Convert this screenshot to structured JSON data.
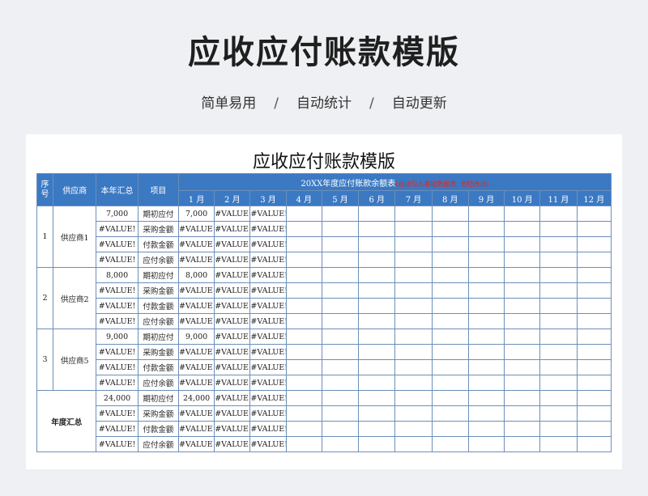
{
  "hero": {
    "title": "应收应付账款模版",
    "features": [
      "简单易用",
      "自动统计",
      "自动更新"
    ],
    "separator": "/"
  },
  "sheet": {
    "title": "应收应付账款模版",
    "headers": {
      "seq": "序号",
      "supplier": "供应商",
      "year_total": "本年汇总",
      "item": "项目",
      "banner": "20XX年度应付账款余额表",
      "banner_note": "(自动引入基础数据表, 勿轻改动)",
      "months": [
        "1 月",
        "2 月",
        "3 月",
        "4 月",
        "5 月",
        "6 月",
        "7 月",
        "8 月",
        "9 月",
        "10 月",
        "11 月",
        "12 月"
      ]
    },
    "groups": [
      {
        "seq": "1",
        "name": "供应商1",
        "rows": [
          {
            "total": "7,000",
            "item": "期初应付",
            "m": [
              "7,000",
              "#VALUE!",
              "#VALUE!"
            ]
          },
          {
            "total": "#VALUE!",
            "item": "采购金额",
            "m": [
              "#VALUE!",
              "#VALUE!",
              "#VALUE!"
            ]
          },
          {
            "total": "#VALUE!",
            "item": "付款金额",
            "m": [
              "#VALUE!",
              "#VALUE!",
              "#VALUE!"
            ]
          },
          {
            "total": "#VALUE!",
            "item": "应付余额",
            "m": [
              "#VALUE!",
              "#VALUE!",
              "#VALUE!"
            ]
          }
        ]
      },
      {
        "seq": "2",
        "name": "供应商2",
        "rows": [
          {
            "total": "8,000",
            "item": "期初应付",
            "m": [
              "8,000",
              "#VALUE!",
              "#VALUE!"
            ]
          },
          {
            "total": "#VALUE!",
            "item": "采购金额",
            "m": [
              "#VALUE!",
              "#VALUE!",
              "#VALUE!"
            ]
          },
          {
            "total": "#VALUE!",
            "item": "付款金额",
            "m": [
              "#VALUE!",
              "#VALUE!",
              "#VALUE!"
            ]
          },
          {
            "total": "#VALUE!",
            "item": "应付余额",
            "m": [
              "#VALUE!",
              "#VALUE!",
              "#VALUE!"
            ]
          }
        ]
      },
      {
        "seq": "3",
        "name": "供应商5",
        "rows": [
          {
            "total": "9,000",
            "item": "期初应付",
            "m": [
              "9,000",
              "#VALUE!",
              "#VALUE!"
            ]
          },
          {
            "total": "#VALUE!",
            "item": "采购金额",
            "m": [
              "#VALUE!",
              "#VALUE!",
              "#VALUE!"
            ]
          },
          {
            "total": "#VALUE!",
            "item": "付款金额",
            "m": [
              "#VALUE!",
              "#VALUE!",
              "#VALUE!"
            ]
          },
          {
            "total": "#VALUE!",
            "item": "应付余额",
            "m": [
              "#VALUE!",
              "#VALUE!",
              "#VALUE!"
            ]
          }
        ]
      }
    ],
    "annual": {
      "label": "年度汇总",
      "rows": [
        {
          "total": "24,000",
          "item": "期初应付",
          "m": [
            "24,000",
            "#VALUE!",
            "#VALUE!"
          ]
        },
        {
          "total": "#VALUE!",
          "item": "采购金额",
          "m": [
            "#VALUE!",
            "#VALUE!",
            "#VALUE!"
          ]
        },
        {
          "total": "#VALUE!",
          "item": "付款金额",
          "m": [
            "#VALUE!",
            "#VALUE!",
            "#VALUE!"
          ]
        },
        {
          "total": "#VALUE!",
          "item": "应付余额",
          "m": [
            "#VALUE!",
            "#VALUE!",
            "#VALUE!"
          ]
        }
      ]
    },
    "colors": {
      "header_bg": "#3b79c3",
      "grid_line": "#6b8fb8",
      "banner_note": "#e8241a"
    }
  }
}
